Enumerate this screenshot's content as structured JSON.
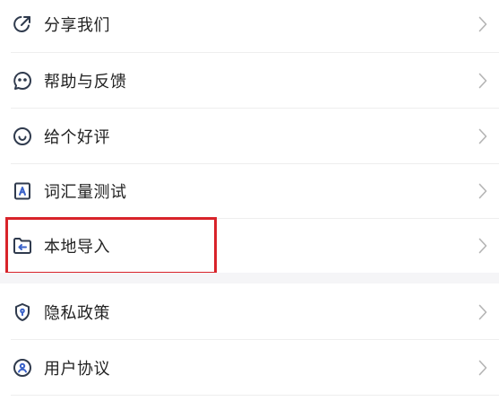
{
  "menu": {
    "items": [
      {
        "label": "分享我们",
        "icon": "share-icon"
      },
      {
        "label": "帮助与反馈",
        "icon": "feedback-icon"
      },
      {
        "label": "给个好评",
        "icon": "smile-icon"
      },
      {
        "label": "词汇量测试",
        "icon": "vocab-test-icon"
      },
      {
        "label": "本地导入",
        "icon": "folder-import-icon"
      },
      {
        "label": "隐私政策",
        "icon": "privacy-shield-icon"
      },
      {
        "label": "用户协议",
        "icon": "user-agreement-icon"
      }
    ]
  },
  "colors": {
    "icon": "#2f3a4d",
    "text": "#222222",
    "chevron": "#b4b4b4",
    "highlight": "#d8232a",
    "section_gap": "#f5f5f7"
  }
}
